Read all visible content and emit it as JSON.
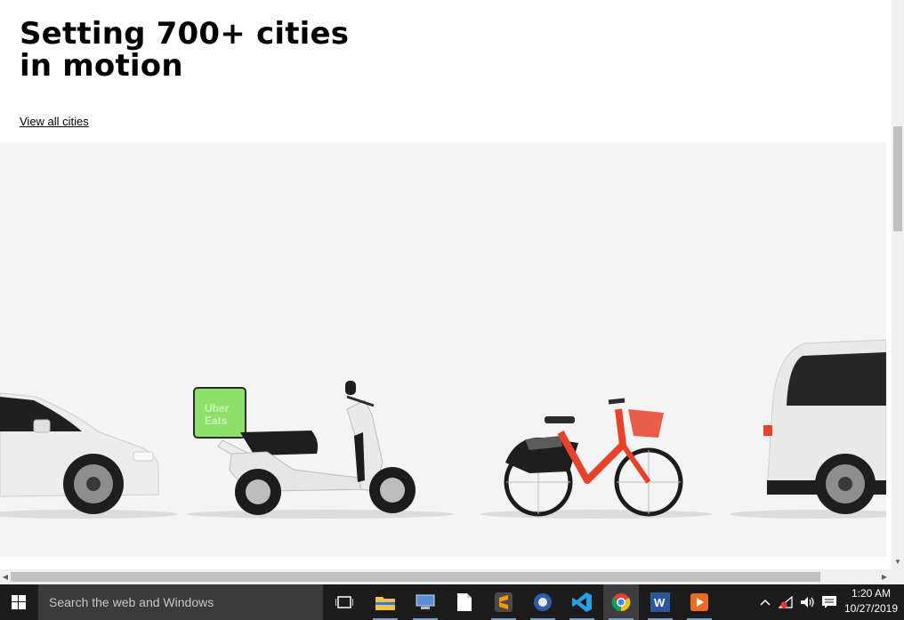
{
  "page": {
    "headline": "Setting 700+ cities in motion",
    "link_label": "View all cities",
    "box_label_line1": "Uber",
    "box_label_line2": "Eats"
  },
  "colors": {
    "eats_green": "#8ee06a",
    "bike_red": "#e8432a",
    "vehicle_white": "#ededed",
    "hero_bg": "#f4f4f4"
  },
  "taskbar": {
    "search_placeholder": "Search the web and Windows",
    "time": "1:20 AM",
    "date": "10/27/2019",
    "apps": [
      "task-view",
      "file-explorer",
      "network-app",
      "document",
      "sublime-text",
      "app-icon",
      "visual-studio-code",
      "google-chrome",
      "microsoft-word",
      "media-player"
    ]
  }
}
